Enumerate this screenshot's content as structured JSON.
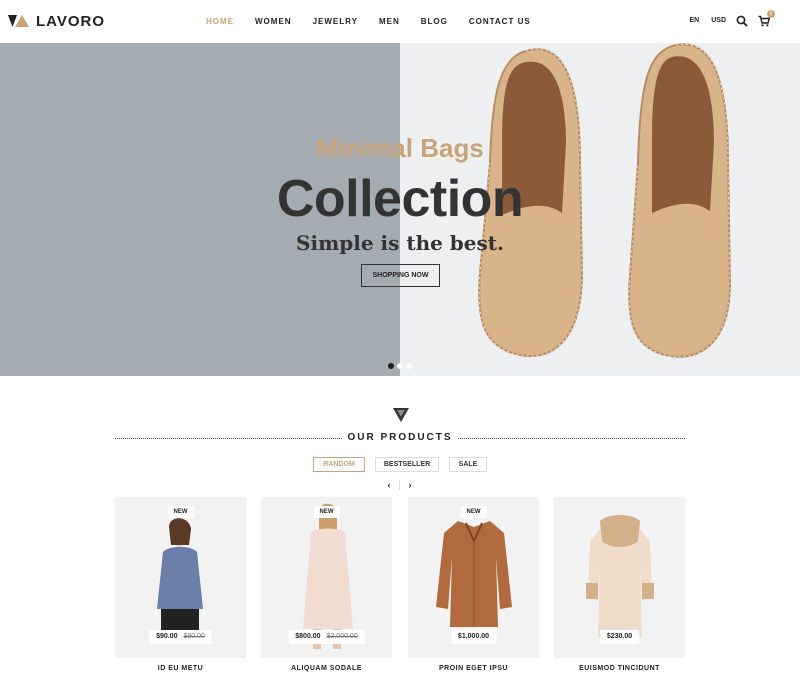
{
  "brand": {
    "logo_text": "LAVORO",
    "accent": "#c9a37a"
  },
  "nav": {
    "items": [
      {
        "label": "HOME"
      },
      {
        "label": "WOMEN"
      },
      {
        "label": "JEWELRY"
      },
      {
        "label": "MEN"
      },
      {
        "label": "BLOG"
      },
      {
        "label": "CONTACT US"
      }
    ],
    "active": "HOME"
  },
  "tools": {
    "language": "EN",
    "currency": "USD",
    "cart_count": "0",
    "icons": [
      "search-icon",
      "cart-icon"
    ]
  },
  "hero": {
    "subtitle": "Minimal Bags",
    "title": "Collection",
    "tagline": "Simple is the best.",
    "button_label": "SHOPPING NOW",
    "slides": 3,
    "active_slide": 1
  },
  "products": {
    "section_title": "OUR PRODUCTS",
    "tabs": [
      "RANDOM",
      "BESTSELLER",
      "SALE"
    ],
    "active_tab": "RANDOM",
    "prev_icon": "chevron-left-icon",
    "next_icon": "chevron-right-icon",
    "items": [
      {
        "name": "ID EU METU",
        "price": "$90.00",
        "old_price": "$80.00",
        "badge": "NEW"
      },
      {
        "name": "ALIQUAM SODALE",
        "price": "$800.00",
        "old_price": "$3,000.00",
        "badge": "NEW"
      },
      {
        "name": "PROIN EGET IPSU",
        "price": "$1,000.00",
        "old_price": "",
        "badge": "NEW"
      },
      {
        "name": "EUISMOD TINCIDUNT",
        "price": "$230.00",
        "old_price": "",
        "badge": ""
      }
    ]
  }
}
